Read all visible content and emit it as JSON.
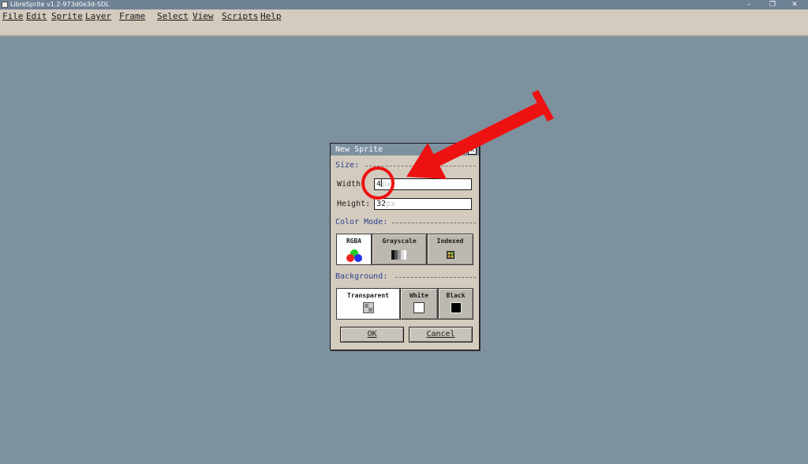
{
  "window": {
    "title": "LibreSprite v1.2-973d0e3d-SDL",
    "minimize_glyph": "–",
    "maximize_glyph": "❐",
    "close_glyph": "✕"
  },
  "menu": {
    "items": [
      "File",
      "Edit",
      "Sprite",
      "Layer",
      "Frame",
      "Select",
      "View",
      "Scripts",
      "Help"
    ]
  },
  "dialog": {
    "title": "New Sprite",
    "close_glyph": "x",
    "size_section": "Size:",
    "width_label": "Width:",
    "width_value": "4",
    "width_unit": "px",
    "height_label": "Height:",
    "height_value": "32",
    "height_unit": "px",
    "color_mode_section": "Color Mode:",
    "color_modes": [
      {
        "label": "RGBA",
        "icon": "rgba-icon",
        "selected": true
      },
      {
        "label": "Grayscale",
        "icon": "grayscale-icon",
        "selected": false
      },
      {
        "label": "Indexed",
        "icon": "indexed-icon",
        "selected": false
      }
    ],
    "background_section": "Background:",
    "backgrounds": [
      {
        "label": "Transparent",
        "icon": "transparent-icon",
        "selected": true
      },
      {
        "label": "White",
        "icon": "white-swatch-icon",
        "selected": false
      },
      {
        "label": "Black",
        "icon": "black-swatch-icon",
        "selected": false
      }
    ],
    "ok_label": "OK",
    "cancel_label": "Cancel"
  },
  "colors": {
    "desktop": "#7d919f",
    "menubar": "#d3cbbe",
    "section_text": "#2c3f8c",
    "annotation": "#ee1111"
  },
  "annotations": [
    "red-arrow",
    "red-circle"
  ]
}
